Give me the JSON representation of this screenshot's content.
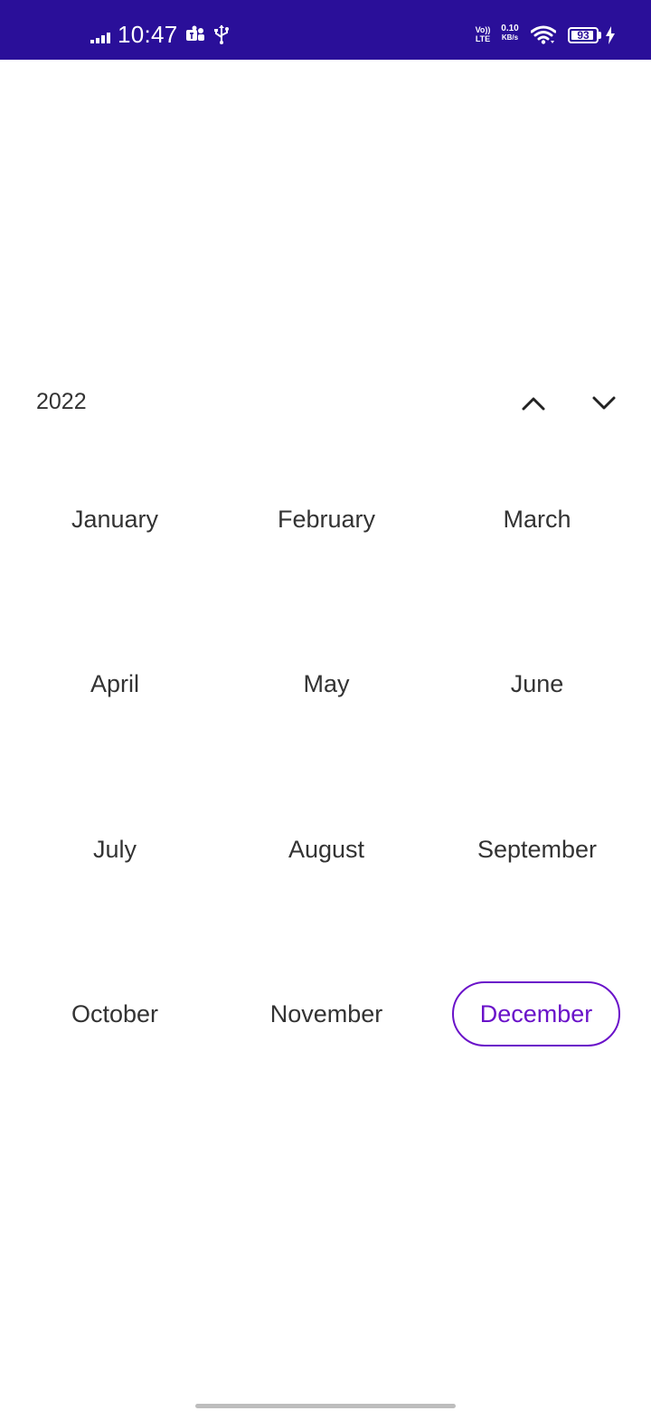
{
  "status_bar": {
    "time": "10:47",
    "network_type_top": "Vo))",
    "network_type_bottom": "LTE",
    "speed_value": "0.10",
    "speed_unit": "KB/s",
    "battery_level": "93",
    "battery_fraction": 0.93,
    "background_color": "#2a0f99",
    "icons": [
      "signal-icon",
      "teams-icon",
      "usb-icon",
      "wifi-icon",
      "battery-icon",
      "charging-icon"
    ]
  },
  "picker": {
    "year": "2022",
    "prev_icon": "chevron-up-icon",
    "next_icon": "chevron-down-icon",
    "accent_color": "#6a12c9",
    "selected_month": "December",
    "months": [
      {
        "label": "January"
      },
      {
        "label": "February"
      },
      {
        "label": "March"
      },
      {
        "label": "April"
      },
      {
        "label": "May"
      },
      {
        "label": "June"
      },
      {
        "label": "July"
      },
      {
        "label": "August"
      },
      {
        "label": "September"
      },
      {
        "label": "October"
      },
      {
        "label": "November"
      },
      {
        "label": "December"
      }
    ]
  }
}
